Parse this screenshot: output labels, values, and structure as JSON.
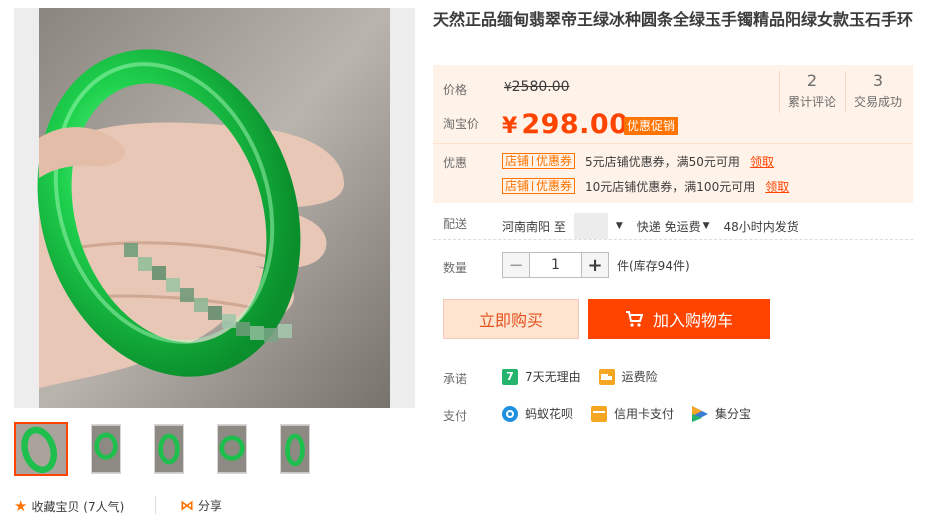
{
  "title": "天然正品缅甸翡翠帝王绿冰种圆条全绿玉手镯精品阳绿女款玉石手环",
  "price": {
    "label": "价格",
    "original_currency": "¥",
    "original": "2580.00",
    "taobao_label": "淘宝价",
    "currency": "¥",
    "current": "298.00",
    "promo_tag": "优惠促销"
  },
  "stats": [
    {
      "value": "2",
      "label": "累计评论"
    },
    {
      "value": "3",
      "label": "交易成功"
    }
  ],
  "coupons": {
    "label": "优惠",
    "items": [
      {
        "tag_left": "店铺",
        "tag_right": "优惠券",
        "desc": "5元店铺优惠券，满50元可用",
        "link": "领取"
      },
      {
        "tag_left": "店铺",
        "tag_right": "优惠券",
        "desc": "10元店铺优惠券，满100元可用",
        "link": "领取"
      }
    ]
  },
  "delivery": {
    "label": "配送",
    "from": "河南南阳 至",
    "shipping": "快递 免运费",
    "dispatch": "48小时内发货"
  },
  "quantity": {
    "label": "数量",
    "minus": "−",
    "value": "1",
    "plus": "+",
    "stock": "件(库存94件)"
  },
  "buttons": {
    "buy_now": "立即购买",
    "add_to_cart": "加入购物车"
  },
  "promise": {
    "label": "承诺",
    "items": [
      {
        "icon": "seven-day-icon",
        "glyph": "7",
        "color": "#26b36b",
        "text": "7天无理由"
      },
      {
        "icon": "shipping-insurance-icon",
        "glyph": "",
        "color": "#f5a623",
        "text": "运费险"
      }
    ]
  },
  "payment": {
    "label": "支付",
    "items": [
      {
        "icon": "huabei-icon",
        "color": "#1e8fe1",
        "text": "蚂蚁花呗"
      },
      {
        "icon": "credit-card-icon",
        "color": "#f5a623",
        "text": "信用卡支付"
      },
      {
        "icon": "jifenbao-icon",
        "color": "#3a7bd5",
        "text": "集分宝"
      }
    ]
  },
  "footer": {
    "collect": "收藏宝贝 (7人气)",
    "share": "分享"
  },
  "colors": {
    "accent": "#ff4400",
    "accent_orange": "#ff7300",
    "price_box_bg": "#fff2e8",
    "jade_green": "#1fbf4e"
  }
}
